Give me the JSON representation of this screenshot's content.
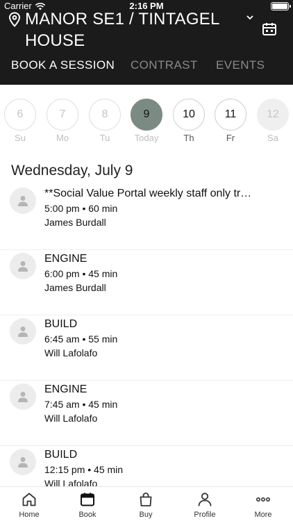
{
  "status_bar": {
    "carrier": "Carrier",
    "time": "2:16 PM"
  },
  "header": {
    "location_title": "MANOR SE1 / TINTAGEL HOUSE",
    "tabs": [
      {
        "label": "BOOK A SESSION",
        "active": true
      },
      {
        "label": "CONTRAST",
        "active": false
      },
      {
        "label": "EVENTS",
        "active": false
      }
    ]
  },
  "date_strip": [
    {
      "num": "6",
      "label": "Su",
      "state": "past"
    },
    {
      "num": "7",
      "label": "Mo",
      "state": "past"
    },
    {
      "num": "8",
      "label": "Tu",
      "state": "past"
    },
    {
      "num": "9",
      "label": "Today",
      "state": "today"
    },
    {
      "num": "10",
      "label": "Th",
      "state": "current"
    },
    {
      "num": "11",
      "label": "Fr",
      "state": "current"
    },
    {
      "num": "12",
      "label": "Sa",
      "state": "disabled"
    }
  ],
  "date_heading": "Wednesday, July 9",
  "sessions": [
    {
      "title": "**Social Value Portal weekly staff only tr…",
      "time": "5:00 pm • 60 min",
      "instructor": "James Burdall"
    },
    {
      "title": "ENGINE",
      "time": "6:00 pm • 45 min",
      "instructor": "James Burdall"
    },
    {
      "title": "BUILD",
      "time": "6:45 am • 55 min",
      "instructor": "Will Lafolafo"
    },
    {
      "title": "ENGINE",
      "time": "7:45 am • 45 min",
      "instructor": "Will Lafolafo"
    },
    {
      "title": "BUILD",
      "time": "12:15 pm • 45 min",
      "instructor": "Will Lafolafo"
    }
  ],
  "bottom_nav": [
    {
      "label": "Home",
      "icon": "home-icon"
    },
    {
      "label": "Book",
      "icon": "calendar-icon",
      "active": true
    },
    {
      "label": "Buy",
      "icon": "bag-icon"
    },
    {
      "label": "Profile",
      "icon": "person-icon"
    },
    {
      "label": "More",
      "icon": "more-icon"
    }
  ],
  "colors": {
    "header_bg": "#1b1b1b",
    "today_accent": "#7b8b83"
  }
}
